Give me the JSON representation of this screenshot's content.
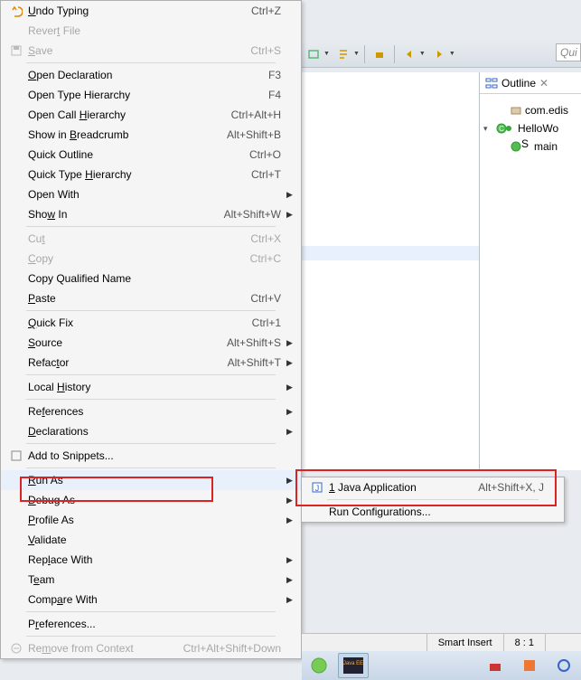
{
  "menu": {
    "undo_typing": "Undo Typing",
    "undo_typing_key": "Ctrl+Z",
    "revert_file": "Revert File",
    "save": "Save",
    "save_key": "Ctrl+S",
    "open_declaration": "Open Declaration",
    "open_declaration_key": "F3",
    "open_type_hierarchy": "Open Type Hierarchy",
    "open_type_hierarchy_key": "F4",
    "open_call_hierarchy": "Open Call Hierarchy",
    "open_call_hierarchy_key": "Ctrl+Alt+H",
    "show_in_breadcrumb": "Show in Breadcrumb",
    "show_in_breadcrumb_key": "Alt+Shift+B",
    "quick_outline": "Quick Outline",
    "quick_outline_key": "Ctrl+O",
    "quick_type_hierarchy": "Quick Type Hierarchy",
    "quick_type_hierarchy_key": "Ctrl+T",
    "open_with": "Open With",
    "show_in": "Show In",
    "show_in_key": "Alt+Shift+W",
    "cut": "Cut",
    "cut_key": "Ctrl+X",
    "copy": "Copy",
    "copy_key": "Ctrl+C",
    "copy_qualified_name": "Copy Qualified Name",
    "paste": "Paste",
    "paste_key": "Ctrl+V",
    "quick_fix": "Quick Fix",
    "quick_fix_key": "Ctrl+1",
    "source": "Source",
    "source_key": "Alt+Shift+S",
    "refactor": "Refactor",
    "refactor_key": "Alt+Shift+T",
    "local_history": "Local History",
    "references": "References",
    "declarations": "Declarations",
    "add_to_snippets": "Add to Snippets...",
    "run_as": "Run As",
    "debug_as": "Debug As",
    "profile_as": "Profile As",
    "validate": "Validate",
    "replace_with": "Replace With",
    "team": "Team",
    "compare_with": "Compare With",
    "preferences": "Preferences...",
    "remove_from_context": "Remove from Context",
    "remove_from_context_key": "Ctrl+Alt+Shift+Down"
  },
  "submenu": {
    "java_application_prefix": "1",
    "java_application": "Java Application",
    "java_application_key": "Alt+Shift+X, J",
    "run_configurations": "Run Configurations..."
  },
  "outline": {
    "tab_label": "Outline",
    "package": "com.edis",
    "class": "HelloWo",
    "method": "main"
  },
  "toolbar": {
    "quick_access_placeholder": "Qui"
  },
  "status": {
    "smart_insert": "Smart Insert",
    "position": "8 : 1"
  }
}
